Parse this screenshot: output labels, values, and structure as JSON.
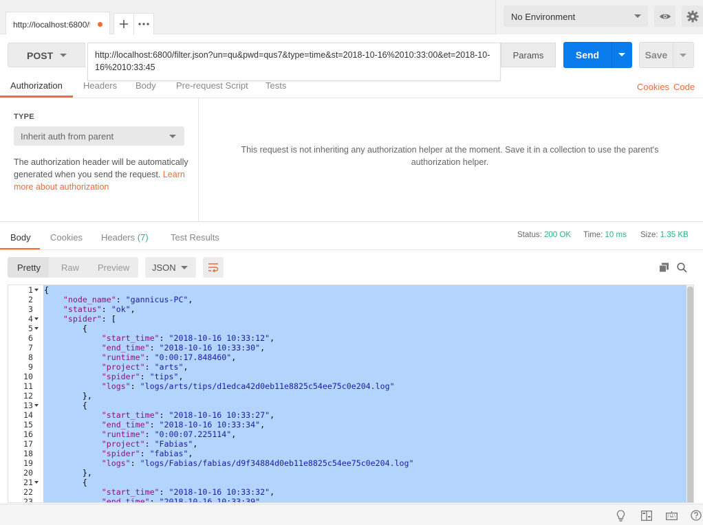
{
  "tabs": {
    "active_tab_label": "http://localhost:6800/f",
    "add_tab_label": "+",
    "more_label": "···"
  },
  "environment": {
    "selected": "No Environment"
  },
  "request": {
    "method": "POST",
    "url": "http://localhost:6800/filter.json?un=qu&pwd=qus7&type=time&st=2018-10-16%2010:33:00&et=2018-10-16%2010:33:45",
    "params_label": "Params",
    "send_label": "Send",
    "save_label": "Save"
  },
  "request_tabs": {
    "items": [
      "Authorization",
      "Headers",
      "Body",
      "Pre-request Script",
      "Tests"
    ],
    "cookies_link": "Cookies",
    "code_link": "Code"
  },
  "auth": {
    "type_label": "TYPE",
    "type_value": "Inherit auth from parent",
    "description": "The authorization header will be automatically generated when you send the request.",
    "learn_more": "Learn more about authorization",
    "message": "This request is not inheriting any authorization helper at the moment. Save it in a collection to use the parent's authorization helper."
  },
  "response": {
    "tabs": [
      "Body",
      "Cookies",
      "Headers",
      "Test Results"
    ],
    "headers_count": "(7)",
    "status_label": "Status:",
    "status_value": "200 OK",
    "time_label": "Time:",
    "time_value": "10 ms",
    "size_label": "Size:",
    "size_value": "1.35 KB",
    "views": [
      "Pretty",
      "Raw",
      "Preview"
    ],
    "format": "JSON"
  },
  "code_lines": [
    {
      "n": "1",
      "fold": true,
      "text": "{"
    },
    {
      "n": "2",
      "fold": false,
      "text": "    \"node_name\": \"gannicus-PC\","
    },
    {
      "n": "3",
      "fold": false,
      "text": "    \"status\": \"ok\","
    },
    {
      "n": "4",
      "fold": true,
      "text": "    \"spider\": ["
    },
    {
      "n": "5",
      "fold": true,
      "text": "        {"
    },
    {
      "n": "6",
      "fold": false,
      "text": "            \"start_time\": \"2018-10-16 10:33:12\","
    },
    {
      "n": "7",
      "fold": false,
      "text": "            \"end_time\": \"2018-10-16 10:33:30\","
    },
    {
      "n": "8",
      "fold": false,
      "text": "            \"runtime\": \"0:00:17.848460\","
    },
    {
      "n": "9",
      "fold": false,
      "text": "            \"project\": \"arts\","
    },
    {
      "n": "10",
      "fold": false,
      "text": "            \"spider\": \"tips\","
    },
    {
      "n": "11",
      "fold": false,
      "text": "            \"logs\": \"logs/arts/tips/d1edca42d0eb11e8825c54ee75c0e204.log\""
    },
    {
      "n": "12",
      "fold": false,
      "text": "        },"
    },
    {
      "n": "13",
      "fold": true,
      "text": "        {"
    },
    {
      "n": "14",
      "fold": false,
      "text": "            \"start_time\": \"2018-10-16 10:33:27\","
    },
    {
      "n": "15",
      "fold": false,
      "text": "            \"end_time\": \"2018-10-16 10:33:34\","
    },
    {
      "n": "16",
      "fold": false,
      "text": "            \"runtime\": \"0:00:07.225114\","
    },
    {
      "n": "17",
      "fold": false,
      "text": "            \"project\": \"Fabias\","
    },
    {
      "n": "18",
      "fold": false,
      "text": "            \"spider\": \"fabias\","
    },
    {
      "n": "19",
      "fold": false,
      "text": "            \"logs\": \"logs/Fabias/fabias/d9f34884d0eb11e8825c54ee75c0e204.log\""
    },
    {
      "n": "20",
      "fold": false,
      "text": "        },"
    },
    {
      "n": "21",
      "fold": true,
      "text": "        {"
    },
    {
      "n": "22",
      "fold": false,
      "text": "            \"start_time\": \"2018-10-16 10:33:32\","
    },
    {
      "n": "23",
      "fold": false,
      "text": "            \"end_time\": \"2018-10-16 10:33:39\","
    }
  ],
  "icons": {
    "eye": "eye-icon",
    "settings": "gear-icon",
    "copy": "copy-icon",
    "search": "search-icon",
    "wrap": "wrap-lines-icon",
    "bulb": "lightbulb-icon",
    "layout": "two-pane-icon",
    "keyboard": "keyboard-icon",
    "help": "help-icon"
  },
  "colors": {
    "accent": "#f26b3a",
    "send": "#097bed",
    "success": "#26b47f",
    "selection": "#b3d4fd"
  }
}
